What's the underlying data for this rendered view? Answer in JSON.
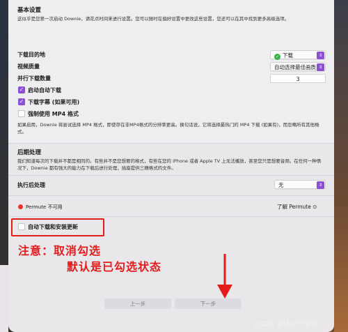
{
  "basic": {
    "heading": "基本设置",
    "desc": "这似乎是您第一次启动 Downie，请花点时间来进行设置。您可以随时在偏好设置中更改这些设置，您还可以在其中找到更多高级选项。",
    "download_dest_label": "下载目的地",
    "download_dest_value": "下载",
    "video_quality_label": "视频质量",
    "video_quality_value": "自动选择最佳画质",
    "parallel_label": "并行下载数量",
    "parallel_value": "3",
    "cb_autostart": "启动自动下载",
    "cb_subtitles": "下载字幕 (如果可用)",
    "cb_mp4": "强制使用 MP4 格式",
    "mp4_desc": "如果启用，Downie 将尝试选择 MP4 格式，即使存在非MP4格式的分辨率更高。换句话说，它将选择最热门的 MP4 下载 (如果有)，而忽略所有其他格式。"
  },
  "post": {
    "heading": "后期处理",
    "desc": "我们知道每次的下载并不都是相同的。有些并不是您想要的格式，有些在您的 iPhone 或者 Apple TV 上无法播放，甚至您只是想要音频。在任何一种情况下，Downie 都有强大的能力在下载后进行处理，插座提供三穗格式的文件。",
    "exec_label": "执行后处理",
    "exec_value": "无",
    "permute_status": "Permute 不可用",
    "permute_link": "了解 Permute"
  },
  "update": {
    "cb_auto_update": "自动下载和安装更新"
  },
  "annotation": {
    "line1": "注意：取消勾选",
    "line2": "默认是已勾选状态"
  },
  "footer": {
    "prev": "上一步",
    "next": "下一步"
  },
  "watermark": "CSDN @Mac分享吧",
  "colors": {
    "accent": "#8c4fd6",
    "annotation": "#e31b1b",
    "status_red": "#e5352a",
    "folder_green": "#36b24a"
  }
}
